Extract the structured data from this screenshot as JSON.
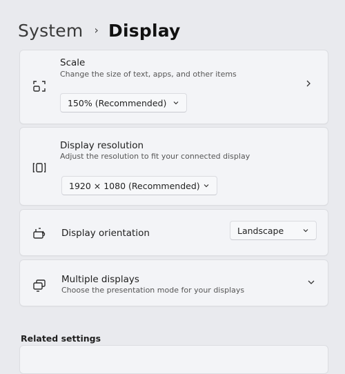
{
  "breadcrumb": {
    "parent": "System",
    "separator": "›",
    "current": "Display"
  },
  "scale": {
    "title": "Scale",
    "subtitle": "Change the size of text, apps, and other items",
    "selected": "150% (Recommended)",
    "icon": "scale-icon"
  },
  "resolution": {
    "title": "Display resolution",
    "subtitle": "Adjust the resolution to fit your connected display",
    "selected": "1920 × 1080 (Recommended)",
    "icon": "resolution-icon"
  },
  "orientation": {
    "title": "Display orientation",
    "selected": "Landscape",
    "icon": "orientation-icon"
  },
  "multiple": {
    "title": "Multiple displays",
    "subtitle": "Choose the presentation mode for your displays",
    "icon": "multiple-displays-icon"
  },
  "related": {
    "heading": "Related settings"
  },
  "colors": {
    "background": "#e9eaee",
    "card": "#f3f4f7",
    "border": "#dcdde1"
  }
}
